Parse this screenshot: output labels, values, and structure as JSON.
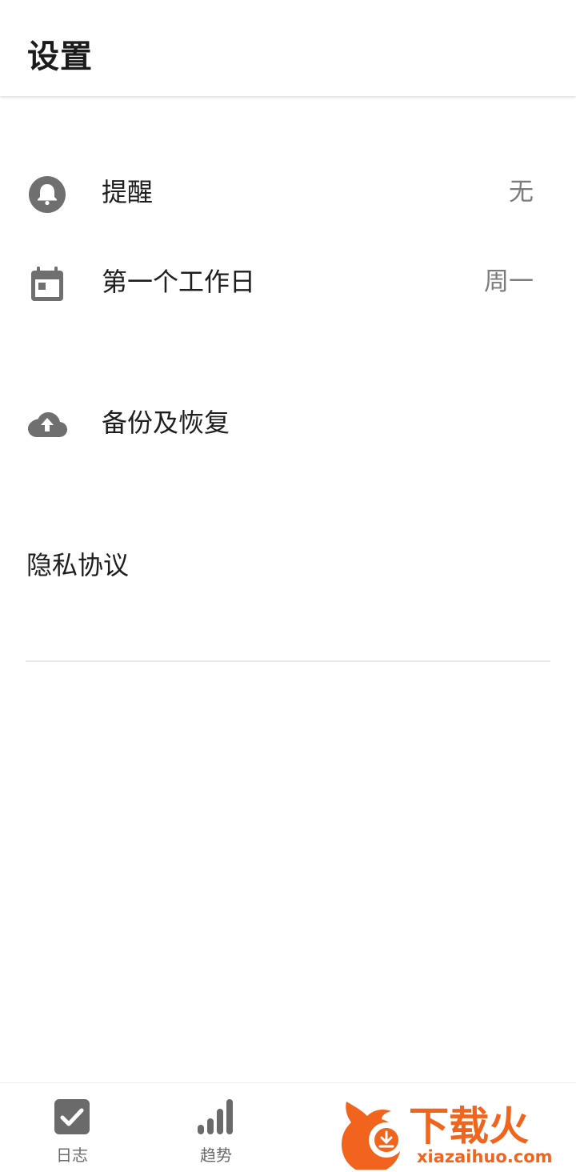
{
  "header": {
    "title": "设置"
  },
  "settings": {
    "reminder": {
      "label": "提醒",
      "value": "无",
      "icon": "bell-icon"
    },
    "first_workday": {
      "label": "第一个工作日",
      "value": "周一",
      "icon": "calendar-icon"
    },
    "backup": {
      "label": "备份及恢复",
      "icon": "cloud-upload-icon"
    },
    "privacy": {
      "label": "隐私协议"
    }
  },
  "bottom_nav": {
    "items": [
      {
        "label": "日志",
        "icon": "checkbox-icon"
      },
      {
        "label": "趋势",
        "icon": "bar-chart-icon"
      }
    ]
  },
  "watermark": {
    "brand": "下载火",
    "site": "xiazaihuo.com"
  },
  "colors": {
    "icon_gray": "#6f6f6f",
    "accent_orange": "#f0641e"
  }
}
